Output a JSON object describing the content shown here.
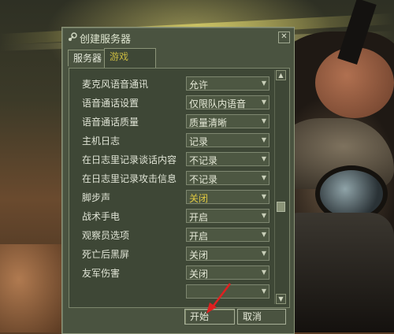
{
  "window": {
    "title": "创建服务器",
    "icon": "steam-icon",
    "close_label": "✕"
  },
  "tabs": [
    {
      "label": "服务器",
      "active": false
    },
    {
      "label": "游戏",
      "active": true
    }
  ],
  "settings": [
    {
      "label": "麦克风语音通讯",
      "value": "允许"
    },
    {
      "label": "语音通话设置",
      "value": "仅限队内语音"
    },
    {
      "label": "语音通话质量",
      "value": "质量清晰"
    },
    {
      "label": "主机日志",
      "value": "记录"
    },
    {
      "label": "在日志里记录谈话内容",
      "value": "不记录"
    },
    {
      "label": "在日志里记录攻击信息",
      "value": "不记录"
    },
    {
      "label": "脚步声",
      "value": "关闭"
    },
    {
      "label": "战术手电",
      "value": "开启"
    },
    {
      "label": "观察员选项",
      "value": "开启"
    },
    {
      "label": "死亡后黑屏",
      "value": "关闭"
    },
    {
      "label": "友军伤害",
      "value": "关闭"
    },
    {
      "label": "",
      "value": ""
    }
  ],
  "buttons": {
    "start": "开始",
    "cancel": "取消"
  },
  "scrollbar": {
    "up": "▲",
    "down": "▼"
  },
  "colors": {
    "window_bg": "#4a5340",
    "highlight_text": "#e0c840",
    "annotation_arrow": "#e02020"
  }
}
